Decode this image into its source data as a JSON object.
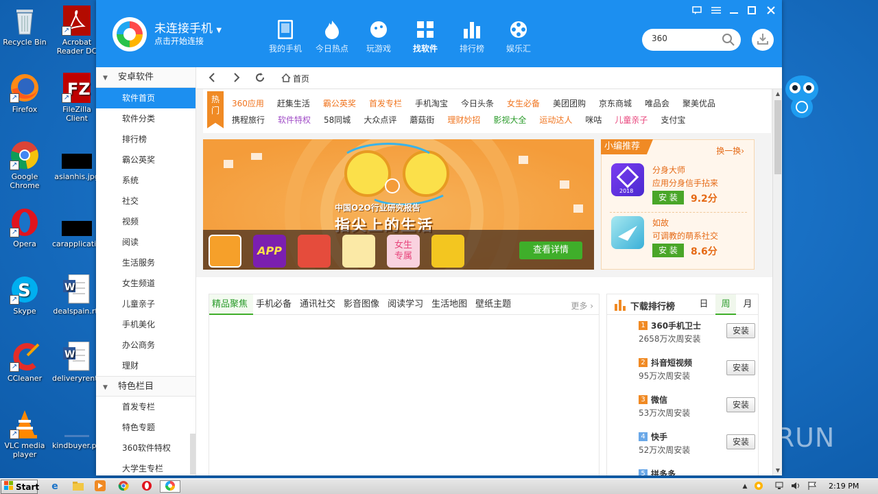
{
  "desktop": {
    "icons": [
      {
        "name": "recycle-bin",
        "label": "Recycle Bin"
      },
      {
        "name": "acrobat",
        "label": "Acrobat Reader DC"
      },
      {
        "name": "firefox",
        "label": "Firefox"
      },
      {
        "name": "filezilla",
        "label": "FileZilla Client"
      },
      {
        "name": "chrome",
        "label": "Google Chrome"
      },
      {
        "name": "asianhis",
        "label": "asianhis.jpg"
      },
      {
        "name": "opera",
        "label": "Opera"
      },
      {
        "name": "carapplication",
        "label": "carapplicati..."
      },
      {
        "name": "skype",
        "label": "Skype"
      },
      {
        "name": "dealspain",
        "label": "dealspain.rtf"
      },
      {
        "name": "ccleaner",
        "label": "CCleaner"
      },
      {
        "name": "deliveryrent",
        "label": "deliveryrent..."
      },
      {
        "name": "vlc",
        "label": "VLC media player"
      },
      {
        "name": "kindbuyer",
        "label": "kindbuyer.png"
      }
    ]
  },
  "header": {
    "title": "未连接手机",
    "subtitle": "点击开始连接",
    "nav": [
      {
        "label": "我的手机",
        "icon": "phone-icon",
        "active": false
      },
      {
        "label": "今日热点",
        "icon": "flame-icon",
        "active": false
      },
      {
        "label": "玩游戏",
        "icon": "gamepad-icon",
        "active": false
      },
      {
        "label": "找软件",
        "icon": "grid-icon",
        "active": true
      },
      {
        "label": "排行榜",
        "icon": "bar-chart-icon",
        "active": false
      },
      {
        "label": "娱乐汇",
        "icon": "film-reel-icon",
        "active": false
      }
    ],
    "search_value": "360"
  },
  "breadcrumb": {
    "home": "首页"
  },
  "sidebar": {
    "sections": [
      {
        "title": "安卓软件",
        "items": [
          "软件首页",
          "软件分类",
          "排行榜",
          "霸公英奖",
          "系统",
          "社交",
          "视频",
          "阅读",
          "生活服务",
          "女生频道",
          "儿童亲子",
          "手机美化",
          "办公商务",
          "理财"
        ]
      },
      {
        "title": "特色栏目",
        "items": [
          "首发专栏",
          "特色专题",
          "360软件特权",
          "大学生专栏"
        ]
      }
    ]
  },
  "hot": {
    "badge": "热门",
    "row1": [
      {
        "t": "360应用",
        "c": "o"
      },
      {
        "t": "赶集生活",
        "c": ""
      },
      {
        "t": "霸公英奖",
        "c": "o"
      },
      {
        "t": "首发专栏",
        "c": "o"
      },
      {
        "t": "手机淘宝",
        "c": ""
      },
      {
        "t": "今日头条",
        "c": ""
      },
      {
        "t": "女生必备",
        "c": "o"
      },
      {
        "t": "美团团购",
        "c": ""
      },
      {
        "t": "京东商城",
        "c": ""
      },
      {
        "t": "唯品会",
        "c": ""
      },
      {
        "t": "聚美优品",
        "c": ""
      }
    ],
    "row2": [
      {
        "t": "携程旅行",
        "c": ""
      },
      {
        "t": "软件特权",
        "c": "p"
      },
      {
        "t": "58同城",
        "c": ""
      },
      {
        "t": "大众点评",
        "c": ""
      },
      {
        "t": "蘑菇街",
        "c": ""
      },
      {
        "t": "理财妙招",
        "c": "o"
      },
      {
        "t": "影视大全",
        "c": "g"
      },
      {
        "t": "运动达人",
        "c": "o"
      },
      {
        "t": "咪咕",
        "c": ""
      },
      {
        "t": "儿童亲子",
        "c": "pk"
      },
      {
        "t": "支付宝",
        "c": ""
      }
    ]
  },
  "banner": {
    "title_small": "中国O2O行业研究报告",
    "title_big": "指尖上的生活",
    "detail_button": "查看详情",
    "app_labels": [
      "APP",
      "女生专属"
    ]
  },
  "pick": {
    "tag": "小编推荐",
    "swap": "换一换›",
    "items": [
      {
        "name": "分身大师",
        "desc": "应用分身信手拈来",
        "install": "安 装",
        "score": "9.2分",
        "badge": "2018"
      },
      {
        "name": "如故",
        "desc": "可调教的萌系社交",
        "install": "安 装",
        "score": "8.6分"
      }
    ]
  },
  "categories": {
    "tabs": [
      "精品聚焦",
      "手机必备",
      "通讯社交",
      "影音图像",
      "阅读学习",
      "生活地图",
      "壁纸主题"
    ],
    "more": "更多"
  },
  "rank": {
    "title": "下载排行榜",
    "periods": [
      "日",
      "周",
      "月"
    ],
    "active_period": 1,
    "items": [
      {
        "no": "1",
        "name": "360手机卫士",
        "count": "2658万次周安装",
        "btn": "安装"
      },
      {
        "no": "2",
        "name": "抖音短视频",
        "count": "95万次周安装",
        "btn": "安装"
      },
      {
        "no": "3",
        "name": "微信",
        "count": "53万次周安装",
        "btn": "安装"
      },
      {
        "no": "4",
        "name": "快手",
        "count": "52万次周安装",
        "btn": "安装"
      },
      {
        "no": "5",
        "name": "拼多多",
        "count": "",
        "btn": ""
      }
    ]
  },
  "watermark": "ANY RUN",
  "taskbar": {
    "start": "Start",
    "time": "2:19 PM"
  },
  "colors": {
    "brand_blue": "#1c8ff0",
    "accent_orange": "#f08a24",
    "install_green": "#49a628"
  }
}
